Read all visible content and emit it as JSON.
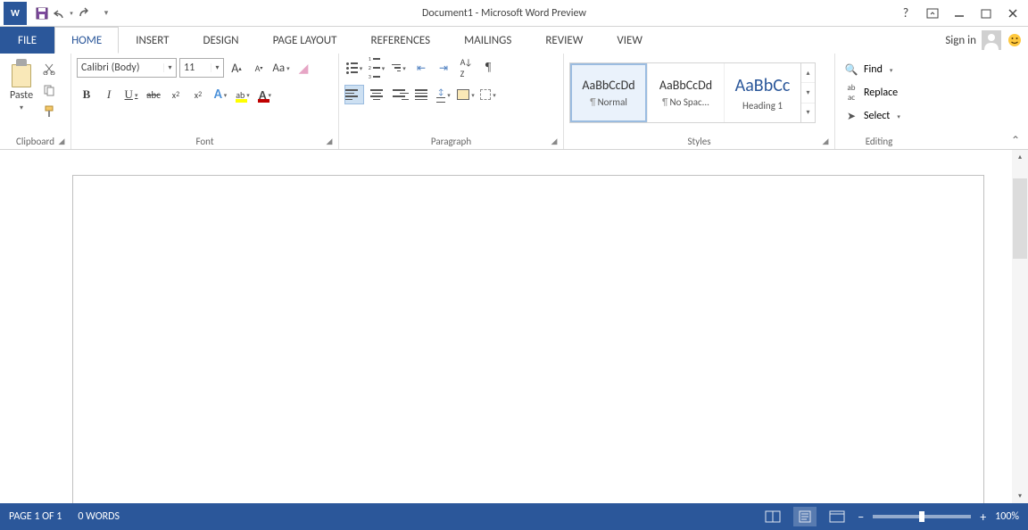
{
  "title": "Document1 - Microsoft Word Preview",
  "qat": {
    "save": "save-icon",
    "undo": "undo-icon",
    "redo": "redo-icon"
  },
  "signin": "Sign in",
  "tabs": {
    "file": "FILE",
    "home": "HOME",
    "insert": "INSERT",
    "design": "DESIGN",
    "pagelayout": "PAGE LAYOUT",
    "references": "REFERENCES",
    "mailings": "MAILINGS",
    "review": "REVIEW",
    "view": "VIEW"
  },
  "clipboard": {
    "paste": "Paste",
    "label": "Clipboard"
  },
  "font": {
    "name": "Calibri (Body)",
    "size": "11",
    "label": "Font",
    "changecase": "Aa"
  },
  "paragraph": {
    "label": "Paragraph"
  },
  "styles": {
    "label": "Styles",
    "preview": "AaBbCcDd",
    "preview3": "AaBbCc",
    "items": [
      {
        "name": "Normal"
      },
      {
        "name": "No Spac..."
      },
      {
        "name": "Heading 1"
      }
    ]
  },
  "editing": {
    "label": "Editing",
    "find": "Find",
    "replace": "Replace",
    "select": "Select"
  },
  "status": {
    "page": "PAGE 1 OF 1",
    "words": "0 WORDS",
    "zoom": "100%"
  }
}
